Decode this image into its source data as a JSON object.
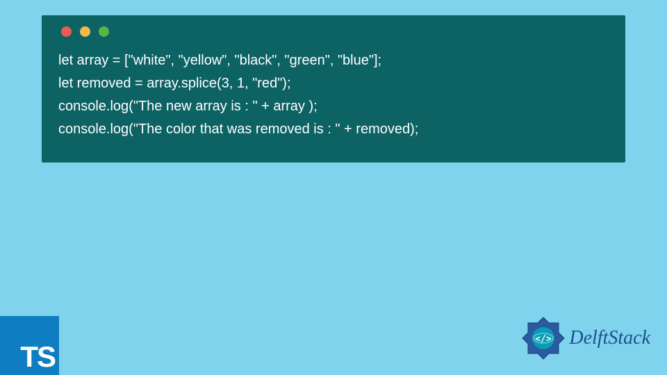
{
  "code": {
    "lines": [
      "let array = [\"white\", \"yellow\", \"black\", \"green\", \"blue\"];",
      "let removed = array.splice(3, 1, \"red\");",
      "console.log(\"The new array is : \" + array );",
      "console.log(\"The color that was removed is : \" + removed);"
    ]
  },
  "ts_badge": {
    "label": "TS"
  },
  "brand": {
    "name": "DelftStack"
  },
  "colors": {
    "background": "#7fd3ed",
    "panel": "#0d6264",
    "code_text": "#ffffff",
    "ts_badge_bg": "#0f7dc2",
    "brand_text": "#1a4f8f",
    "dot_red": "#ed5b55",
    "dot_yellow": "#f2b94c",
    "dot_green": "#57b548"
  }
}
